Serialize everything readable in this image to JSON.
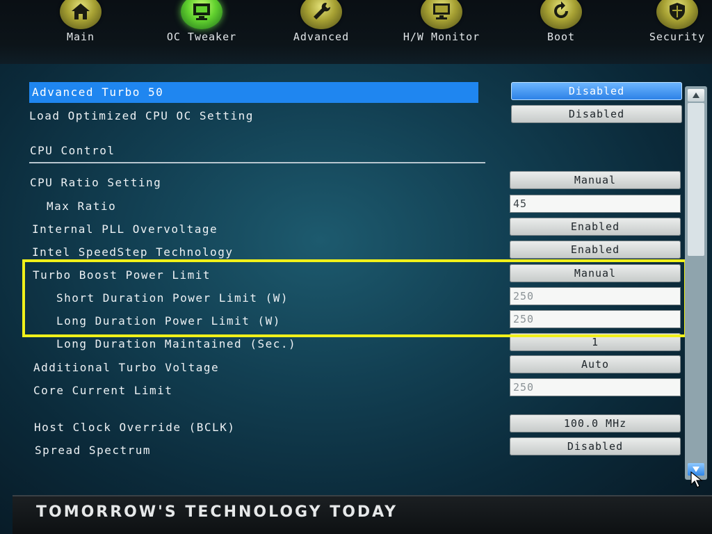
{
  "nav": {
    "items": [
      {
        "label": "Main",
        "icon": "home-icon"
      },
      {
        "label": "OC Tweaker",
        "icon": "monitor-chip-icon"
      },
      {
        "label": "Advanced",
        "icon": "wrench-icon"
      },
      {
        "label": "H/W Monitor",
        "icon": "monitor-icon"
      },
      {
        "label": "Boot",
        "icon": "refresh-icon"
      },
      {
        "label": "Security",
        "icon": "shield-icon"
      }
    ],
    "active": "OC Tweaker"
  },
  "settings": {
    "advanced_turbo_50": {
      "label": "Advanced Turbo 50",
      "value": "Disabled"
    },
    "load_optimized_cpu_oc": {
      "label": "Load Optimized CPU OC Setting",
      "value": "Disabled"
    },
    "section_cpu_control": "CPU Control",
    "cpu_ratio_setting": {
      "label": "CPU Ratio Setting",
      "value": "Manual"
    },
    "max_ratio": {
      "label": "Max Ratio",
      "value": "45"
    },
    "internal_pll_overvoltage": {
      "label": "Internal PLL Overvoltage",
      "value": "Enabled"
    },
    "intel_speedstep": {
      "label": "Intel SpeedStep Technology",
      "value": "Enabled"
    },
    "turbo_boost_power_limit": {
      "label": "Turbo Boost Power Limit",
      "value": "Manual"
    },
    "short_duration_power_limit": {
      "label": "Short Duration Power Limit (W)",
      "value": "250"
    },
    "long_duration_power_limit": {
      "label": "Long Duration Power Limit (W)",
      "value": "250"
    },
    "long_duration_maintained": {
      "label": "Long Duration Maintained (Sec.)",
      "value": "1"
    },
    "additional_turbo_voltage": {
      "label": "Additional Turbo Voltage",
      "value": "Auto"
    },
    "core_current_limit": {
      "label": "Core Current Limit",
      "value": "250"
    },
    "host_clock_override": {
      "label": "Host Clock Override (BCLK)",
      "value": "100.0 MHz"
    },
    "spread_spectrum": {
      "label": "Spread Spectrum",
      "value": "Disabled"
    }
  },
  "footer": {
    "tagline": "TOMORROW'S TECHNOLOGY TODAY"
  },
  "colors": {
    "selected_row": "#1f86f0",
    "active_nav": "#62d22f",
    "highlight_box": "#f0f01a"
  }
}
